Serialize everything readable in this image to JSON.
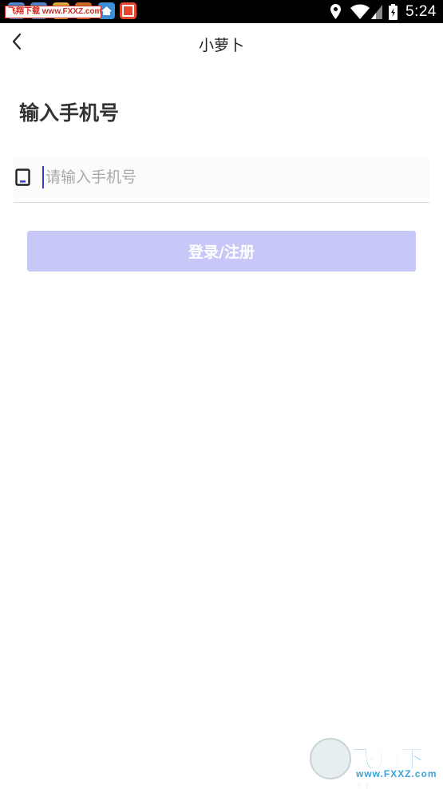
{
  "status_bar": {
    "time": "5:24",
    "watermark_tag": "飞翔下载 www.FXXZ.com",
    "icons": [
      "location-icon",
      "wifi-icon",
      "signal-icon",
      "battery-icon"
    ]
  },
  "nav": {
    "back_icon": "chevron-left-icon",
    "title": "小萝卜"
  },
  "main": {
    "heading": "输入手机号",
    "phone_input": {
      "placeholder": "请输入手机号",
      "value": "",
      "icon": "phone-icon"
    },
    "login_button": "登录/注册"
  },
  "watermark": {
    "logo_text": "飞翔下载",
    "url": "www.FXXZ.com"
  },
  "colors": {
    "accent": "#3b3bd1",
    "button_disabled": "#c7c7f8",
    "heading": "#333333"
  }
}
